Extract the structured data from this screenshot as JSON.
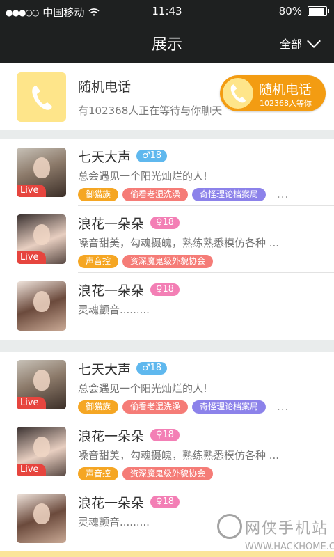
{
  "status_bar": {
    "carrier": "中国移动",
    "signal": "●●●○○",
    "time": "11:43",
    "battery_text": "80%",
    "battery_level": 0.8
  },
  "header": {
    "title": "展示",
    "filter_label": "全部"
  },
  "random_call": {
    "title": "随机电话",
    "subtitle": "有102368人正在等待与你聊天",
    "button_label": "随机电话",
    "button_sub": "102368人等你"
  },
  "groups": [
    {
      "items": [
        {
          "name": "七天大声",
          "gender_symbol": "♂",
          "age": "18",
          "bio": "总会遇见一个阳光灿烂的人!",
          "live": "Live",
          "tags": [
            "御猫族",
            "偷看老湿洗澡",
            "奇怪理论档案局"
          ],
          "more": "..."
        },
        {
          "name": "浪花一朵朵",
          "gender_symbol": "♀",
          "age": "18",
          "bio": "嗓音甜美，勾魂摄魄，熟练熟悉模仿各种 ...",
          "live": "Live",
          "tags": [
            "声音控",
            "资深魔鬼级外貌协会"
          ]
        },
        {
          "name": "浪花一朵朵",
          "gender_symbol": "♀",
          "age": "18",
          "bio": "灵魂颤音........."
        }
      ]
    },
    {
      "items": [
        {
          "name": "七天大声",
          "gender_symbol": "♂",
          "age": "18",
          "bio": "总会遇见一个阳光灿烂的人!",
          "live": "Live",
          "tags": [
            "御猫族",
            "偷看老湿洗澡",
            "奇怪理论档案局"
          ],
          "more": "..."
        },
        {
          "name": "浪花一朵朵",
          "gender_symbol": "♀",
          "age": "18",
          "bio": "嗓音甜美，勾魂摄魄，熟练熟悉模仿各种 ...",
          "live": "Live",
          "tags": [
            "声音控",
            "资深魔鬼级外貌协会"
          ]
        },
        {
          "name": "浪花一朵朵",
          "gender_symbol": "♀",
          "age": "18",
          "bio": "灵魂颤音........."
        }
      ]
    }
  ],
  "watermark": {
    "brand": "网侠手机站",
    "url": "WWW.HACKHOME.COM"
  },
  "colors": {
    "accent": "#f39c12",
    "header_bg": "#1e2020",
    "icon_bg": "#fee58a",
    "live": "#e6453e",
    "male": "#5fb8ee",
    "female": "#f37fb5"
  }
}
